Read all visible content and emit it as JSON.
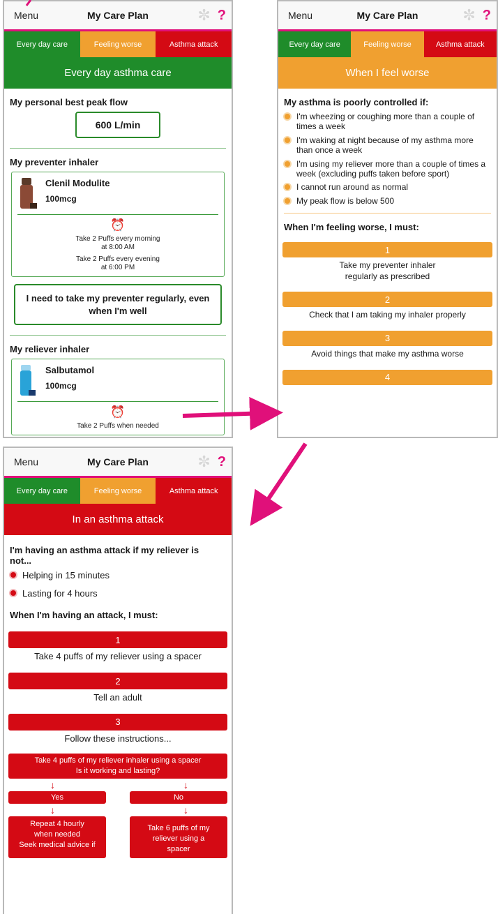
{
  "screen1": {
    "nav": {
      "menu": "Menu",
      "title": "My Care Plan",
      "help": "?"
    },
    "tabs": [
      "Every day care",
      "Feeling worse",
      "Asthma attack"
    ],
    "banner": "Every day asthma care",
    "peak_heading": "My personal best peak flow",
    "peak_value": "600 L/min",
    "preventer_heading": "My preventer inhaler",
    "preventer": {
      "name": "Clenil Modulite",
      "dose": "100mcg",
      "line1": "Take 2 Puffs every morning",
      "line1b": "at 8:00 AM",
      "line2": "Take 2 Puffs every evening",
      "line2b": "at 6:00 PM"
    },
    "regular_msg": "I need to take my preventer regularly, even when I'm well",
    "reliever_heading": "My reliever inhaler",
    "reliever": {
      "name": "Salbutamol",
      "dose": "100mcg",
      "line1": "Take 2 Puffs when needed"
    }
  },
  "screen2": {
    "nav": {
      "menu": "Menu",
      "title": "My Care Plan",
      "help": "?"
    },
    "tabs": [
      "Every day care",
      "Feeling worse",
      "Asthma attack"
    ],
    "banner": "When I feel worse",
    "poorly_heading": "My asthma is poorly controlled if:",
    "bullets": [
      "I'm wheezing or coughing more than a couple of times a week",
      "I'm waking at night because of my asthma more than once a week",
      "I'm using my reliever more than a couple of times a week (excluding puffs taken before sport)",
      "I cannot run around as normal",
      "My peak flow is below 500"
    ],
    "must_heading": "When I'm feeling worse, I must:",
    "steps": [
      {
        "num": "1",
        "text": "Take my preventer inhaler regularly as prescribed"
      },
      {
        "num": "2",
        "text": "Check that I am taking my inhaler properly"
      },
      {
        "num": "3",
        "text": "Avoid things that make my asthma worse"
      },
      {
        "num": "4",
        "text": ""
      }
    ]
  },
  "screen3": {
    "nav": {
      "menu": "Menu",
      "title": "My Care Plan",
      "help": "?"
    },
    "tabs": [
      "Every day care",
      "Feeling worse",
      "Asthma attack"
    ],
    "banner": "In an asthma attack",
    "attack_heading": "I'm having an asthma attack if my reliever is not...",
    "bullets": [
      "Helping in 15 minutes",
      "Lasting for 4 hours"
    ],
    "must_heading": "When I'm having an attack, I must:",
    "steps": [
      {
        "num": "1",
        "text": "Take 4 puffs of my reliever using a spacer"
      },
      {
        "num": "2",
        "text": "Tell an adult"
      },
      {
        "num": "3",
        "text": "Follow these instructions..."
      }
    ],
    "flow": {
      "top_line1": "Take 4 puffs of my reliever inhaler using a spacer",
      "top_line2": "Is it working and lasting?",
      "arrow": "↓",
      "yes": "Yes",
      "no": "No",
      "yes_result_line1": "Repeat 4 hourly",
      "yes_result_line2": "when needed",
      "yes_result_line3": "Seek medical advice if",
      "no_result_line1": "Take 6 puffs of my",
      "no_result_line2": "reliever using a",
      "no_result_line3": "spacer"
    }
  },
  "colors": {
    "green": "#1f8c2a",
    "orange": "#f0a030",
    "red": "#d40a14",
    "accent": "#e0107a"
  },
  "icons": [
    "gear-icon",
    "help-icon",
    "alarm-clock-icon",
    "inhaler-icon",
    "arrow-down-icon"
  ]
}
